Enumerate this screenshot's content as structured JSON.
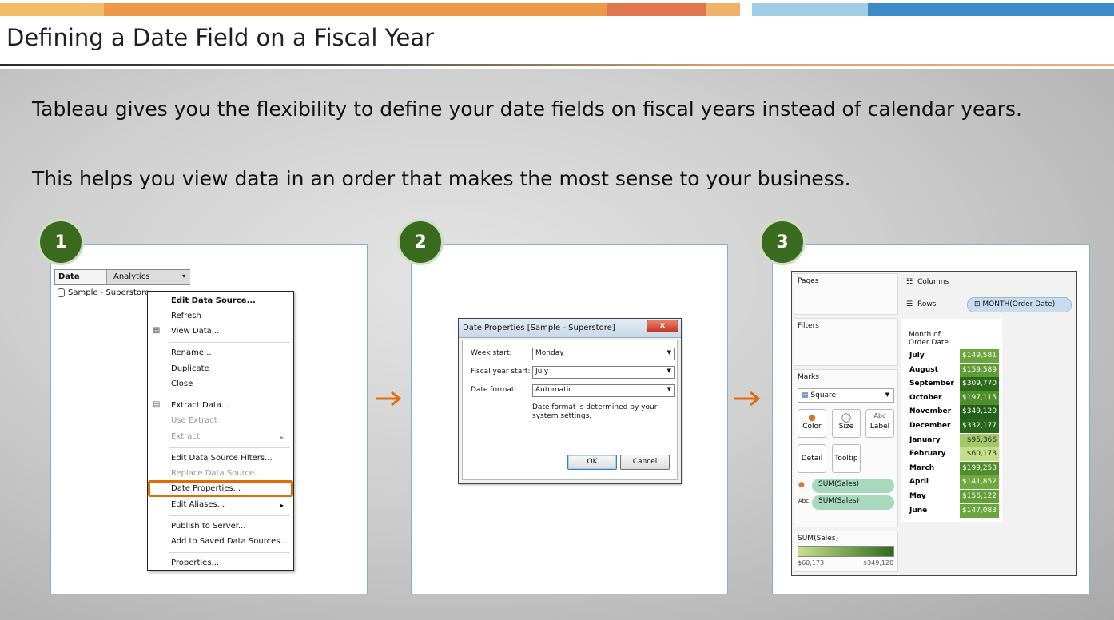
{
  "title": "Defining a Date Field on a Fiscal Year",
  "intro": {
    "line1": "Tableau gives you the flexibility to define your date fields on fiscal years instead of calendar years.",
    "line2": "This helps you view data in an order that makes the most sense to your business."
  },
  "steps": [
    "1",
    "2",
    "3"
  ],
  "colors": {
    "step_circle": "#3a6a1e",
    "highlight": "#e36c0a",
    "panel_border": "#7eb2d8"
  },
  "panel1": {
    "tabs": {
      "data": "Data",
      "analytics": "Analytics"
    },
    "datasource": "Sample - Superstore",
    "menu": [
      "Edit Data Source...",
      "Refresh",
      "View Data...",
      "Rename...",
      "Duplicate",
      "Close",
      "Extract Data...",
      "Use Extract",
      "Extract",
      "Edit Data Source Filters...",
      "Replace Data Source...",
      "Date Properties...",
      "Edit Aliases...",
      "Publish to Server...",
      "Add to Saved Data Sources...",
      "Properties..."
    ]
  },
  "panel2": {
    "dialog_title": "Date Properties [Sample - Superstore]",
    "close": "x",
    "week_start_label": "Week start:",
    "week_start_value": "Monday",
    "fiscal_label": "Fiscal year start:",
    "fiscal_value": "July",
    "format_label": "Date format:",
    "format_value": "Automatic",
    "note": "Date format is determined by your system settings.",
    "ok": "OK",
    "cancel": "Cancel"
  },
  "panel3": {
    "pages": "Pages",
    "filters": "Filters",
    "marks": "Marks",
    "mark_type": "Square",
    "cards": [
      "Color",
      "Size",
      "Label",
      "Detail",
      "Tooltip"
    ],
    "color_pill": "SUM(Sales)",
    "label_pill": "SUM(Sales)",
    "legend_title": "SUM(Sales)",
    "legend_min": "$60,173",
    "legend_max": "$349,120",
    "columns_label": "Columns",
    "rows_label": "Rows",
    "rows_pill": "MONTH(Order Date)",
    "table_header": "Month of Order Date",
    "rows": [
      {
        "month": "July",
        "value": "$149,581",
        "color": "#6ba53c"
      },
      {
        "month": "August",
        "value": "$159,589",
        "color": "#5f9c35"
      },
      {
        "month": "September",
        "value": "$309,770",
        "color": "#2d6b1a"
      },
      {
        "month": "October",
        "value": "$197,115",
        "color": "#4f8f2c"
      },
      {
        "month": "November",
        "value": "$349,120",
        "color": "#23601a"
      },
      {
        "month": "December",
        "value": "$332,177",
        "color": "#2a661b"
      },
      {
        "month": "January",
        "value": "$95,366",
        "color": "#a3c86a"
      },
      {
        "month": "February",
        "value": "$60,173",
        "color": "#c5de8a"
      },
      {
        "month": "March",
        "value": "$199,253",
        "color": "#4e8e2c"
      },
      {
        "month": "April",
        "value": "$141,852",
        "color": "#6ea83e"
      },
      {
        "month": "May",
        "value": "$156,122",
        "color": "#62a037"
      },
      {
        "month": "June",
        "value": "$147,083",
        "color": "#6ba63d"
      }
    ]
  }
}
